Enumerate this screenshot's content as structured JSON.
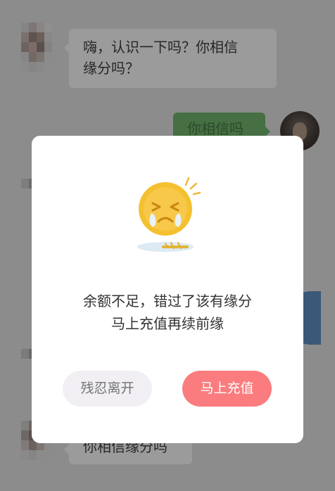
{
  "chat": {
    "messages": [
      {
        "side": "left",
        "line1": "嗨，认识一下吗？你相信",
        "line2": "缘分吗？"
      },
      {
        "side": "right",
        "text": "你相信吗"
      },
      {
        "side": "left",
        "text": "你相信缘分吗"
      }
    ]
  },
  "dialog": {
    "icon": "crying-sun-emoji",
    "message_line1": "余额不足，错过了该有缘分",
    "message_line2": "马上充值再续前缘",
    "leave_label": "残忍离开",
    "recharge_label": "马上充值"
  },
  "colors": {
    "overlay": "#8c8c8c",
    "dialog_bg": "#ffffff",
    "recharge_button": "#fa7c7e",
    "leave_button": "#f1eff3",
    "emoji_yellow": "#f7c433"
  }
}
